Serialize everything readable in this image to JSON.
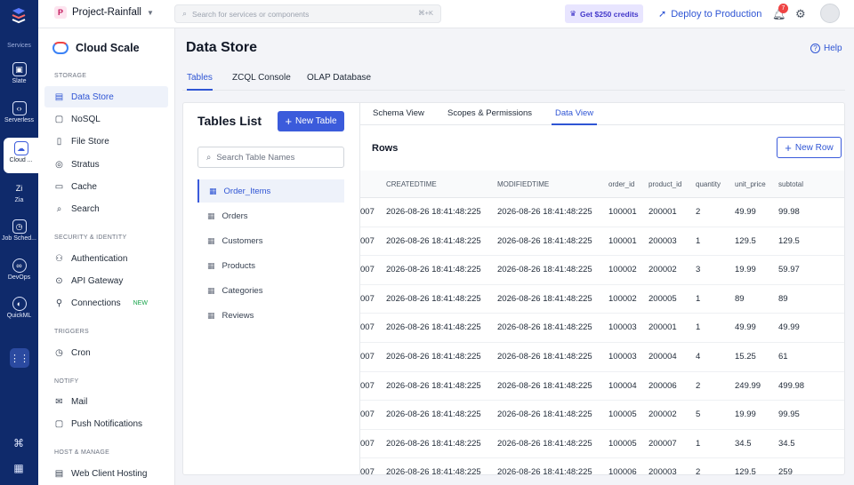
{
  "rail": {
    "services_label": "Services",
    "items": [
      {
        "label": "Slate",
        "icon": "slate-icon"
      },
      {
        "label": "Serverless",
        "icon": "serverless-icon"
      },
      {
        "label": "Cloud ...",
        "icon": "cloud-scale-icon"
      },
      {
        "label": "Zia",
        "icon": "zia-icon"
      },
      {
        "label": "Job Sched...",
        "icon": "job-scheduler-icon"
      },
      {
        "label": "DevOps",
        "icon": "devops-icon"
      },
      {
        "label": "QuickML",
        "icon": "quickml-icon"
      }
    ]
  },
  "topbar": {
    "project_initial": "P",
    "project_name": "Project-Rainfall",
    "search_placeholder": "Search for services or components",
    "search_shortcut": "⌘+K",
    "credits_label": "Get $250 credits",
    "deploy_label": "Deploy to Production",
    "notification_count": "7"
  },
  "sidebar": {
    "title": "Cloud Scale",
    "sections": [
      {
        "label": "STORAGE"
      },
      {
        "label": "SECURITY & IDENTITY"
      },
      {
        "label": "TRIGGERS"
      },
      {
        "label": "NOTIFY"
      },
      {
        "label": "HOST & MANAGE"
      }
    ],
    "items": [
      {
        "label": "Data Store"
      },
      {
        "label": "NoSQL"
      },
      {
        "label": "File Store"
      },
      {
        "label": "Stratus"
      },
      {
        "label": "Cache"
      },
      {
        "label": "Search"
      },
      {
        "label": "Authentication"
      },
      {
        "label": "API Gateway"
      },
      {
        "label": "Connections",
        "tag": "NEW"
      },
      {
        "label": "Cron"
      },
      {
        "label": "Mail"
      },
      {
        "label": "Push Notifications"
      },
      {
        "label": "Web Client Hosting"
      }
    ]
  },
  "main": {
    "title": "Data Store",
    "help_label": "Help",
    "tabs": [
      {
        "label": "Tables"
      },
      {
        "label": "ZCQL Console"
      },
      {
        "label": "OLAP Database"
      }
    ]
  },
  "tables_list": {
    "title": "Tables List",
    "new_table_label": "New Table",
    "search_placeholder": "Search Table Names",
    "items": [
      {
        "label": "Order_Items"
      },
      {
        "label": "Orders"
      },
      {
        "label": "Customers"
      },
      {
        "label": "Products"
      },
      {
        "label": "Categories"
      },
      {
        "label": "Reviews"
      }
    ]
  },
  "data_view": {
    "sub_tabs": [
      {
        "label": "Schema View"
      },
      {
        "label": "Scopes & Permissions"
      },
      {
        "label": "Data View"
      }
    ],
    "rows_title": "Rows",
    "new_row_label": "New Row",
    "columns": [
      "CREATEDTIME",
      "MODIFIEDTIME",
      "order_id",
      "product_id",
      "quantity",
      "unit_price",
      "subtotal"
    ],
    "rows": [
      [
        "007",
        "2026-08-26 18:41:48:225",
        "2026-08-26 18:41:48:225",
        "100001",
        "200001",
        "2",
        "49.99",
        "99.98"
      ],
      [
        "007",
        "2026-08-26 18:41:48:225",
        "2026-08-26 18:41:48:225",
        "100001",
        "200003",
        "1",
        "129.5",
        "129.5"
      ],
      [
        "007",
        "2026-08-26 18:41:48:225",
        "2026-08-26 18:41:48:225",
        "100002",
        "200002",
        "3",
        "19.99",
        "59.97"
      ],
      [
        "007",
        "2026-08-26 18:41:48:225",
        "2026-08-26 18:41:48:225",
        "100002",
        "200005",
        "1",
        "89",
        "89"
      ],
      [
        "007",
        "2026-08-26 18:41:48:225",
        "2026-08-26 18:41:48:225",
        "100003",
        "200001",
        "1",
        "49.99",
        "49.99"
      ],
      [
        "007",
        "2026-08-26 18:41:48:225",
        "2026-08-26 18:41:48:225",
        "100003",
        "200004",
        "4",
        "15.25",
        "61"
      ],
      [
        "007",
        "2026-08-26 18:41:48:225",
        "2026-08-26 18:41:48:225",
        "100004",
        "200006",
        "2",
        "249.99",
        "499.98"
      ],
      [
        "007",
        "2026-08-26 18:41:48:225",
        "2026-08-26 18:41:48:225",
        "100005",
        "200002",
        "5",
        "19.99",
        "99.95"
      ],
      [
        "007",
        "2026-08-26 18:41:48:225",
        "2026-08-26 18:41:48:225",
        "100005",
        "200007",
        "1",
        "34.5",
        "34.5"
      ],
      [
        "007",
        "2026-08-26 18:41:48:225",
        "2026-08-26 18:41:48:225",
        "100006",
        "200003",
        "2",
        "129.5",
        "259"
      ]
    ]
  },
  "colors": {
    "rail_bg": "#0f2a6b",
    "accent": "#3b5bdb",
    "link": "#2f55d4"
  }
}
